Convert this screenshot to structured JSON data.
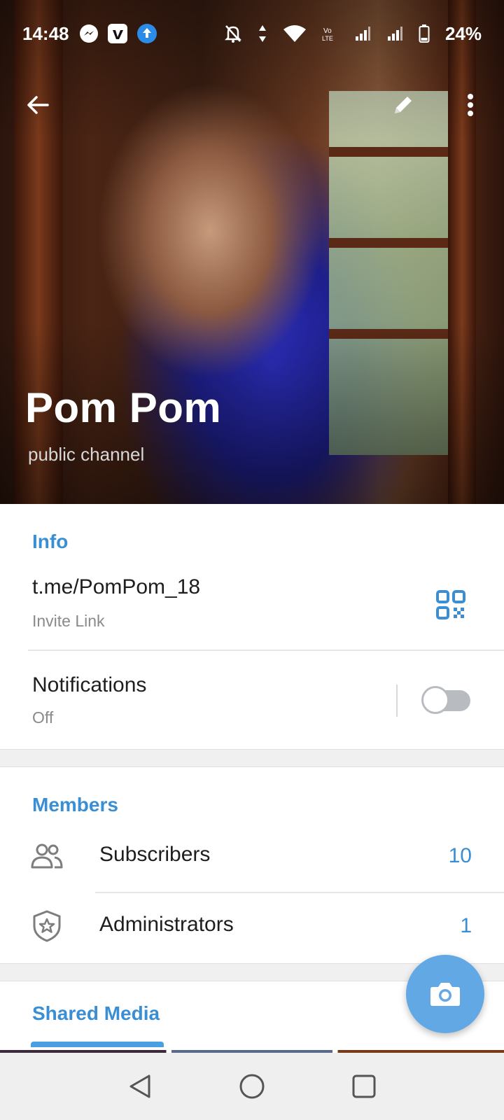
{
  "status_bar": {
    "time": "14:48",
    "battery": "24%"
  },
  "channel": {
    "name": "Pom Pom",
    "type": "public channel"
  },
  "info": {
    "header": "Info",
    "link": "t.me/PomPom_18",
    "link_label": "Invite Link",
    "notifications_label": "Notifications",
    "notifications_value": "Off",
    "notifications_enabled": false
  },
  "members": {
    "header": "Members",
    "items": [
      {
        "label": "Subscribers",
        "count": "10",
        "icon": "people-icon"
      },
      {
        "label": "Administrators",
        "count": "1",
        "icon": "shield-star-icon"
      }
    ]
  },
  "shared_media": {
    "header": "Shared Media"
  },
  "colors": {
    "accent": "#3a8fd4",
    "fab": "#62a8e4"
  }
}
